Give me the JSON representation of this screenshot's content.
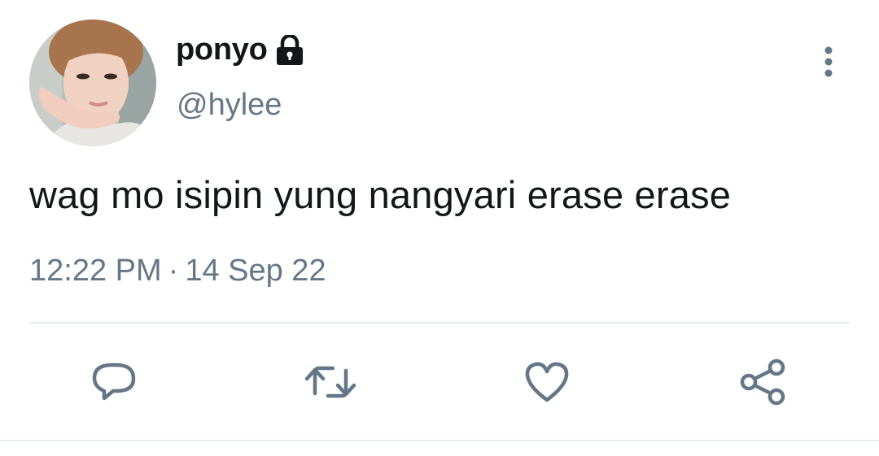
{
  "tweet": {
    "author": {
      "display_name": "ponyo",
      "handle": "@hylee",
      "protected_icon": "lock-icon",
      "avatar": "profile-photo"
    },
    "text": "wag mo isipin yung nangyari erase erase",
    "time": "12:22 PM",
    "separator": "·",
    "date": "14 Sep 22",
    "menu_icon": "more-vertical-icon"
  },
  "actions": [
    {
      "name": "reply",
      "icon": "reply-icon"
    },
    {
      "name": "retweet",
      "icon": "retweet-icon"
    },
    {
      "name": "like",
      "icon": "heart-icon"
    },
    {
      "name": "share",
      "icon": "share-icon"
    }
  ],
  "colors": {
    "text_primary": "#14171a",
    "text_secondary": "#657786",
    "divider": "#e6ecf0",
    "background": "#ffffff"
  }
}
